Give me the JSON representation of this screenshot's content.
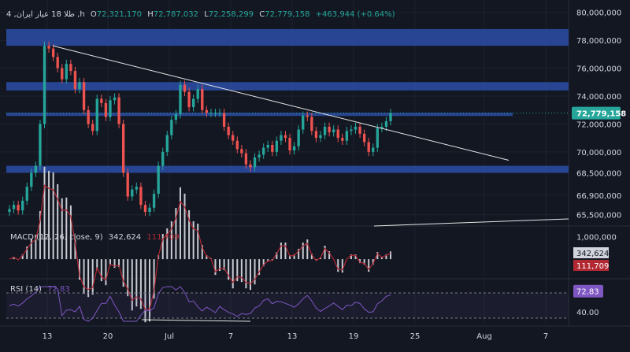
{
  "header": {
    "symbol": "4 ,طلا 18 عیار ایران ,h",
    "open_prefix": "O",
    "open": "72,321,170",
    "high_prefix": "H",
    "high": "72,787,032",
    "low_prefix": "L",
    "low": "72,258,299",
    "close_prefix": "C",
    "close": "72,779,158",
    "change": "+463,944 (+0.64%)"
  },
  "macd_label": {
    "name": "MACD (12, 26, close, 9)",
    "hist": "342,624",
    "signal": "111,709"
  },
  "rsi_label": {
    "name": "RSI (14)",
    "value": "72.83"
  },
  "colors": {
    "bg": "#131722",
    "grid": "#1e222d",
    "up": "#26a69a",
    "down": "#ef5350",
    "zone": "#2a4a9e",
    "price_badge": "#26a69a",
    "rsi": "#7e57c2",
    "macd_signal": "#b22833"
  },
  "chart_data": [
    {
      "type": "candlestick",
      "title": "طلا 18 عیار ایران",
      "timeframe": "4h",
      "x_ticks": [
        "13",
        "20",
        "Jul",
        "7",
        "13",
        "19",
        "25",
        "Aug",
        "7"
      ],
      "y_ticks": [
        "80,000,000",
        "78,000,000",
        "76,000,000",
        "74,000,000",
        "72,000,000",
        "70,000,000",
        "68,500,000",
        "66,900,000",
        "65,500,000"
      ],
      "ylim": [
        64800000,
        80600000
      ],
      "last_price": "72,779,158",
      "close_series": [
        65900000,
        66200000,
        65800000,
        66500000,
        67500000,
        68500000,
        69000000,
        72000000,
        77600000,
        77400000,
        76800000,
        76000000,
        75200000,
        76300000,
        75800000,
        74500000,
        75000000,
        73000000,
        72000000,
        71500000,
        73800000,
        73500000,
        72500000,
        73700000,
        73900000,
        72000000,
        68500000,
        66800000,
        67300000,
        67500000,
        66200000,
        65700000,
        66000000,
        67000000,
        69000000,
        70000000,
        71200000,
        72300000,
        72700000,
        74800000,
        74300000,
        73200000,
        73800000,
        74500000,
        73000000,
        72800000,
        72800000,
        72800000,
        72800000,
        71800000,
        71200000,
        70800000,
        70200000,
        69900000,
        69100000,
        68900000,
        69600000,
        69800000,
        70300000,
        70500000,
        70000000,
        70800000,
        71200000,
        71000000,
        70100000,
        70400000,
        71600000,
        72600000,
        72500000,
        71500000,
        71000000,
        71200000,
        71800000,
        71400000,
        71600000,
        71000000,
        70800000,
        71500000,
        71600000,
        71800000,
        71300000,
        70700000,
        70000000,
        70300000,
        71700000,
        71800000,
        72200000,
        72779158
      ],
      "zones": [
        {
          "top": 78800000,
          "bottom": 77600000
        },
        {
          "top": 75000000,
          "bottom": 74400000
        },
        {
          "top": 72800000,
          "bottom": 72600000
        },
        {
          "top": 69000000,
          "bottom": 68500000
        }
      ],
      "trendline": {
        "from": [
          "Jun 13",
          77600000
        ],
        "to": [
          "Aug 1",
          69400000
        ]
      }
    },
    {
      "type": "bar",
      "title": "MACD (12, 26, close, 9)",
      "y_ticks": [
        "1,000,000"
      ],
      "ylim": [
        -800000,
        1400000
      ],
      "hist_value": "342,624",
      "signal_value": "111,709"
    },
    {
      "type": "line",
      "title": "RSI (14)",
      "y_ticks": [
        "40.00"
      ],
      "ylim": [
        20,
        90
      ],
      "bands": [
        70,
        30
      ],
      "last": "72.83"
    }
  ]
}
